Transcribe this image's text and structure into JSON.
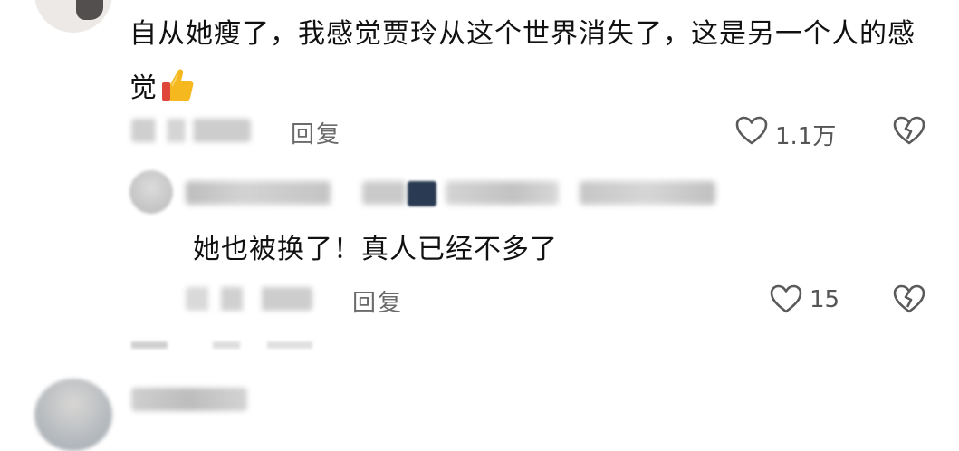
{
  "comments": [
    {
      "text": "自从她瘦了，我感觉贾玲从这个世界消失了，这是另一个人的感觉",
      "emoji": "thumbs-up-icon",
      "reply_label": "回复",
      "like_count": "1.1万",
      "replies": [
        {
          "text": "她也被换了！真人已经不多了",
          "reply_label": "回复",
          "like_count": "15"
        }
      ]
    }
  ],
  "colors": {
    "text": "#111111",
    "secondary": "#6b6b6b",
    "background": "#ffffff"
  }
}
